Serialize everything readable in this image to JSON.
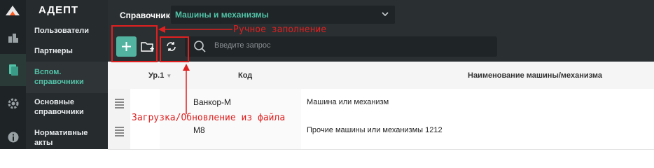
{
  "app": {
    "brand": "АДЕПТ"
  },
  "nav": {
    "items": [
      {
        "label": "Пользователи"
      },
      {
        "label": "Партнеры"
      },
      {
        "label": "Вспом. справочники",
        "line1": "Вспом.",
        "line2": "справочники"
      },
      {
        "label": "Основные справочники",
        "line1": "Основные",
        "line2": "справочники"
      },
      {
        "label": "Нормативные акты",
        "line1": "Нормативные",
        "line2": "акты"
      }
    ]
  },
  "toolbar": {
    "dict_label": "Справочник",
    "dict_value": "Машины и механизмы",
    "search_placeholder": "Введите запрос"
  },
  "table": {
    "columns": {
      "level": "Ур.1",
      "code": "Код",
      "name": "Наименование машины/механизма"
    },
    "rows": [
      {
        "code": "Ванкор-М",
        "name": "Машина или механизм"
      },
      {
        "code": "М8",
        "name": "Прочие машины или механизмы 1212"
      }
    ]
  },
  "annotations": {
    "manual": "Ручное заполнение",
    "load": "Загрузка/Обновление из файла"
  },
  "colors": {
    "accent": "#52c3a8",
    "annotation": "#e02020",
    "dark": "#262b2e"
  }
}
